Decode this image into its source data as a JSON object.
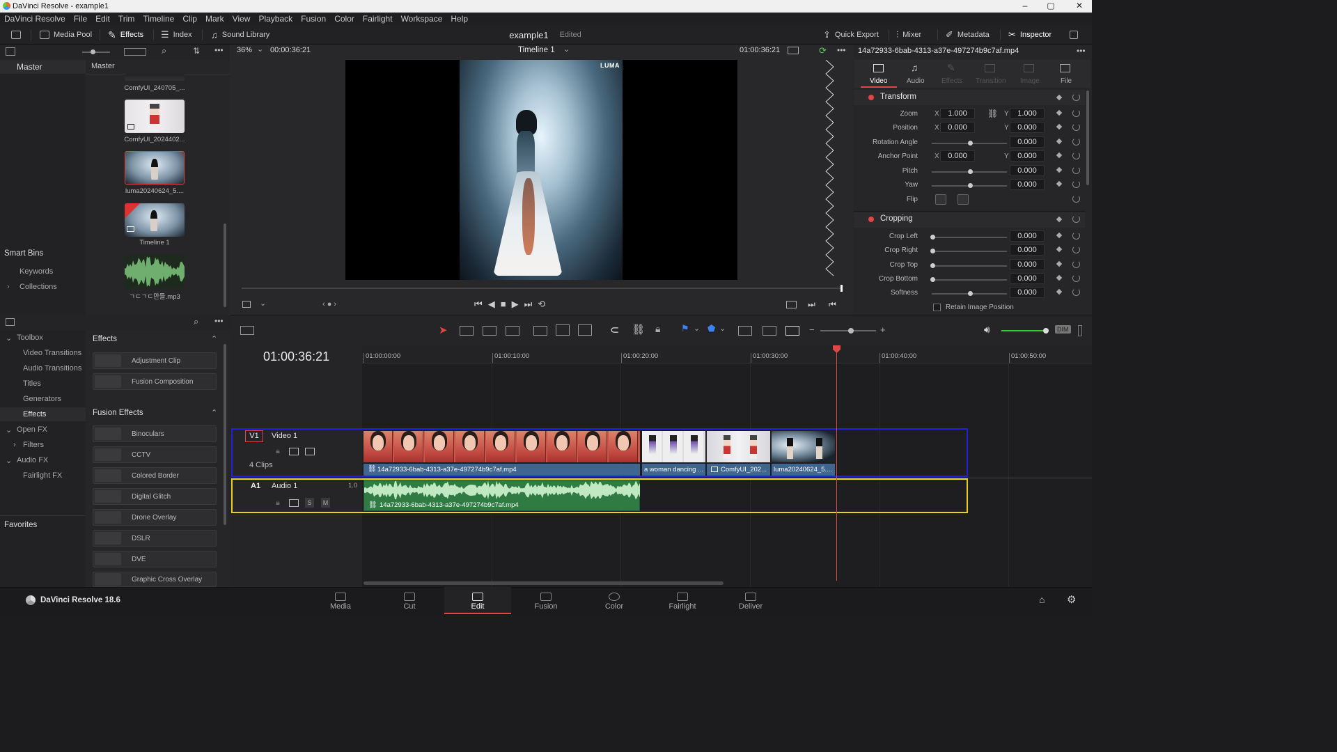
{
  "window": {
    "title": "DaVinci Resolve - example1",
    "min": "–",
    "max": "▢",
    "close": "✕"
  },
  "menu": [
    "DaVinci Resolve",
    "File",
    "Edit",
    "Trim",
    "Timeline",
    "Clip",
    "Mark",
    "View",
    "Playback",
    "Fusion",
    "Color",
    "Fairlight",
    "Workspace",
    "Help"
  ],
  "toolbar": {
    "media_pool": "Media Pool",
    "effects": "Effects",
    "index": "Index",
    "sound_library": "Sound Library",
    "project": "example1",
    "status": "Edited",
    "quick_export": "Quick Export",
    "mixer": "Mixer",
    "metadata": "Metadata",
    "inspector": "Inspector"
  },
  "viewer": {
    "zoom": "36%",
    "timecode_left": "00:00:36:21",
    "timeline_name": "Timeline 1",
    "timecode_right": "01:00:36:21",
    "watermark": "LUMA"
  },
  "bins": {
    "master": "Master",
    "master_header": "Master",
    "smart_bins": "Smart Bins",
    "keywords": "Keywords",
    "collections": "Collections"
  },
  "clips": [
    {
      "label": "ComfyUI_240705_..."
    },
    {
      "label": "ComfyUI_2024402..."
    },
    {
      "label": "luma20240624_5...."
    },
    {
      "label": "Timeline 1"
    },
    {
      "label": "ㄱㄷㄱㄷ만들.mp3"
    }
  ],
  "effects_tree": {
    "toolbox": "Toolbox",
    "video_transitions": "Video Transitions",
    "audio_transitions": "Audio Transitions",
    "titles": "Titles",
    "generators": "Generators",
    "effects": "Effects",
    "open_fx": "Open FX",
    "filters": "Filters",
    "audio_fx": "Audio FX",
    "fairlight_fx": "Fairlight FX",
    "favorites": "Favorites"
  },
  "effects_list": {
    "header": "Effects",
    "items": [
      "Adjustment Clip",
      "Fusion Composition"
    ],
    "fusion_header": "Fusion Effects",
    "fusion_items": [
      "Binoculars",
      "CCTV",
      "Colored Border",
      "Digital Glitch",
      "Drone Overlay",
      "DSLR",
      "DVE",
      "Graphic Cross Overlay"
    ]
  },
  "inspector": {
    "clip_name": "14a72933-6bab-4313-a37e-497274b9c7af.mp4",
    "tabs": [
      "Video",
      "Audio",
      "Effects",
      "Transition",
      "Image",
      "File"
    ],
    "transform": {
      "title": "Transform",
      "zoom": "Zoom",
      "zoom_x": "1.000",
      "zoom_y": "1.000",
      "position": "Position",
      "pos_x": "0.000",
      "pos_y": "0.000",
      "rotation": "Rotation Angle",
      "rotation_val": "0.000",
      "anchor": "Anchor Point",
      "anchor_x": "0.000",
      "anchor_y": "0.000",
      "pitch": "Pitch",
      "pitch_val": "0.000",
      "yaw": "Yaw",
      "yaw_val": "0.000",
      "flip": "Flip"
    },
    "cropping": {
      "title": "Cropping",
      "left": "Crop Left",
      "left_val": "0.000",
      "right": "Crop Right",
      "right_val": "0.000",
      "top": "Crop Top",
      "top_val": "0.000",
      "bottom": "Crop Bottom",
      "bottom_val": "0.000",
      "softness": "Softness",
      "softness_val": "0.000",
      "retain": "Retain Image Position"
    },
    "axis_x": "X",
    "axis_y": "Y"
  },
  "timeline": {
    "timecode": "01:00:36:21",
    "ruler": [
      "01:00:00:00",
      "01:00:10:00",
      "01:00:20:00",
      "01:00:30:00",
      "01:00:40:00",
      "01:00:50:00"
    ],
    "v1": {
      "id": "V1",
      "name": "Video 1",
      "clips_count": "4 Clips"
    },
    "a1": {
      "id": "A1",
      "name": "Audio 1",
      "level": "1.0",
      "solo": "S",
      "mute": "M"
    },
    "video_clips": [
      "14a72933-6bab-4313-a37e-497274b9c7af.mp4",
      "a woman dancing ...",
      "ComfyUI_202...",
      "luma20240624_5...."
    ],
    "audio_clip": "14a72933-6bab-4313-a37e-497274b9c7af.mp4",
    "dim": "DIM"
  },
  "footer": {
    "app": "DaVinci Resolve 18.6",
    "pages": [
      "Media",
      "Cut",
      "Edit",
      "Fusion",
      "Color",
      "Fairlight",
      "Deliver"
    ]
  }
}
